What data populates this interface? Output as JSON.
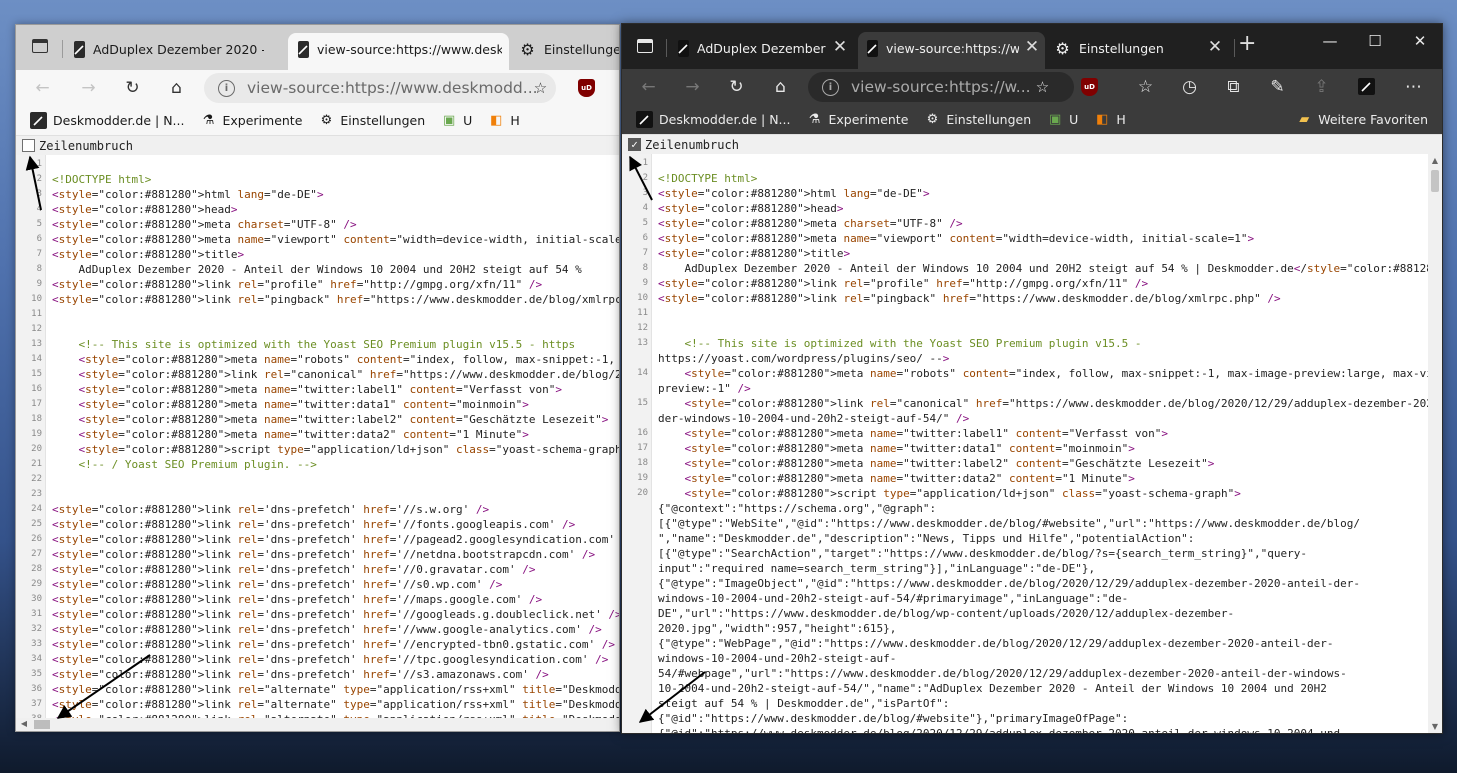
{
  "left_window": {
    "tabs": [
      {
        "label": "AdDuplex Dezember 2020 - A",
        "icon": "pen-icon"
      },
      {
        "label": "view-source:https://www.desk",
        "icon": "pen-icon"
      },
      {
        "label": "Einstellungen",
        "icon": "gear-icon"
      }
    ],
    "address": "view-source:https://www.deskmodd...",
    "favorites": [
      {
        "label": "Deskmodder.de | N...",
        "icon": "pen-icon"
      },
      {
        "label": "Experimente",
        "icon": "flask-icon"
      },
      {
        "label": "Einstellungen",
        "icon": "gear-icon"
      },
      {
        "label": "U",
        "icon": "extension-icon"
      },
      {
        "label": "H",
        "icon": "squares-icon"
      }
    ],
    "wrap_label": "Zeilenumbruch",
    "wrap_checked": false,
    "code_lines": [
      {
        "n": "1",
        "t": ""
      },
      {
        "n": "2",
        "t": "<!DOCTYPE html>"
      },
      {
        "n": "3",
        "t": "<html lang=\"de-DE\">"
      },
      {
        "n": "4",
        "t": "<head>"
      },
      {
        "n": "5",
        "t": "<meta charset=\"UTF-8\" />"
      },
      {
        "n": "6",
        "t": "<meta name=\"viewport\" content=\"width=device-width, initial-scale=1\">"
      },
      {
        "n": "7",
        "t": "<title>"
      },
      {
        "n": "8",
        "t": "    AdDuplex Dezember 2020 - Anteil der Windows 10 2004 und 20H2 steigt auf 54 %"
      },
      {
        "n": "9",
        "t": "<link rel=\"profile\" href=\"http://gmpg.org/xfn/11\" />"
      },
      {
        "n": "10",
        "t": "<link rel=\"pingback\" href=\"https://www.deskmodder.de/blog/xmlrpc.php\" />"
      },
      {
        "n": "11",
        "t": ""
      },
      {
        "n": "12",
        "t": ""
      },
      {
        "n": "13",
        "t": "    <!-- This site is optimized with the Yoast SEO Premium plugin v15.5 - https"
      },
      {
        "n": "14",
        "t": "    <meta name=\"robots\" content=\"index, follow, max-snippet:-1, max-image-previe"
      },
      {
        "n": "15",
        "t": "    <link rel=\"canonical\" href=\"https://www.deskmodder.de/blog/2020/12/29/addupl"
      },
      {
        "n": "16",
        "t": "    <meta name=\"twitter:label1\" content=\"Verfasst von\">"
      },
      {
        "n": "17",
        "t": "    <meta name=\"twitter:data1\" content=\"moinmoin\">"
      },
      {
        "n": "18",
        "t": "    <meta name=\"twitter:label2\" content=\"Geschätzte Lesezeit\">"
      },
      {
        "n": "19",
        "t": "    <meta name=\"twitter:data2\" content=\"1 Minute\">"
      },
      {
        "n": "20",
        "t": "    <script type=\"application/ld+json\" class=\"yoast-schema-graph\">{\"@context\":\"h"
      },
      {
        "n": "21",
        "t": "    <!-- / Yoast SEO Premium plugin. -->"
      },
      {
        "n": "22",
        "t": ""
      },
      {
        "n": "23",
        "t": ""
      },
      {
        "n": "24",
        "t": "<link rel='dns-prefetch' href='//s.w.org' />"
      },
      {
        "n": "25",
        "t": "<link rel='dns-prefetch' href='//fonts.googleapis.com' />"
      },
      {
        "n": "26",
        "t": "<link rel='dns-prefetch' href='//pagead2.googlesyndication.com' />"
      },
      {
        "n": "27",
        "t": "<link rel='dns-prefetch' href='//netdna.bootstrapcdn.com' />"
      },
      {
        "n": "28",
        "t": "<link rel='dns-prefetch' href='//0.gravatar.com' />"
      },
      {
        "n": "29",
        "t": "<link rel='dns-prefetch' href='//s0.wp.com' />"
      },
      {
        "n": "30",
        "t": "<link rel='dns-prefetch' href='//maps.google.com' />"
      },
      {
        "n": "31",
        "t": "<link rel='dns-prefetch' href='//googleads.g.doubleclick.net' />"
      },
      {
        "n": "32",
        "t": "<link rel='dns-prefetch' href='//www.google-analytics.com' />"
      },
      {
        "n": "33",
        "t": "<link rel='dns-prefetch' href='//encrypted-tbn0.gstatic.com' />"
      },
      {
        "n": "34",
        "t": "<link rel='dns-prefetch' href='//tpc.googlesyndication.com' />"
      },
      {
        "n": "35",
        "t": "<link rel='dns-prefetch' href='//s3.amazonaws.com' />"
      },
      {
        "n": "36",
        "t": "<link rel=\"alternate\" type=\"application/rss+xml\" title=\"Deskmodder.de &raquo; Fe"
      },
      {
        "n": "37",
        "t": "<link rel=\"alternate\" type=\"application/rss+xml\" title=\"Deskmodder.de &raquo; Ko"
      },
      {
        "n": "38",
        "t": "<link rel=\"alternate\" type=\"application/rss+xml\" title=\"Deskmodder.de &raquo; Ad"
      }
    ]
  },
  "right_window": {
    "tabs": [
      {
        "label": "AdDuplex Dezember 20",
        "icon": "pen-icon"
      },
      {
        "label": "view-source:https://ww",
        "icon": "pen-icon"
      },
      {
        "label": "Einstellungen",
        "icon": "gear-icon"
      }
    ],
    "address": "view-source:https://w...",
    "favorites": [
      {
        "label": "Deskmodder.de | N...",
        "icon": "pen-icon"
      },
      {
        "label": "Experimente",
        "icon": "flask-icon"
      },
      {
        "label": "Einstellungen",
        "icon": "gear-icon"
      },
      {
        "label": "U",
        "icon": "extension-icon"
      },
      {
        "label": "H",
        "icon": "squares-icon"
      }
    ],
    "other_favorites": "Weitere Favoriten",
    "wrap_label": "Zeilenumbruch",
    "wrap_checked": true,
    "code_lines": [
      {
        "n": "1",
        "t": ""
      },
      {
        "n": "2",
        "t": "<!DOCTYPE html>"
      },
      {
        "n": "3",
        "t": "<html lang=\"de-DE\">"
      },
      {
        "n": "4",
        "t": "<head>"
      },
      {
        "n": "5",
        "t": "<meta charset=\"UTF-8\" />"
      },
      {
        "n": "6",
        "t": "<meta name=\"viewport\" content=\"width=device-width, initial-scale=1\">"
      },
      {
        "n": "7",
        "t": "<title>"
      },
      {
        "n": "8",
        "t": "    AdDuplex Dezember 2020 - Anteil der Windows 10 2004 und 20H2 steigt auf 54 % | Deskmodder.de</title>"
      },
      {
        "n": "9",
        "t": "<link rel=\"profile\" href=\"http://gmpg.org/xfn/11\" />"
      },
      {
        "n": "10",
        "t": "<link rel=\"pingback\" href=\"https://www.deskmodder.de/blog/xmlrpc.php\" />"
      },
      {
        "n": "11",
        "t": ""
      },
      {
        "n": "12",
        "t": ""
      },
      {
        "n": "13",
        "t": "    <!-- This site is optimized with the Yoast SEO Premium plugin v15.5 -"
      },
      {
        "n": "",
        "t": "https://yoast.com/wordpress/plugins/seo/ -->"
      },
      {
        "n": "14",
        "t": "    <meta name=\"robots\" content=\"index, follow, max-snippet:-1, max-image-preview:large, max-video-"
      },
      {
        "n": "",
        "t": "preview:-1\" />"
      },
      {
        "n": "15",
        "t": "    <link rel=\"canonical\" href=\"https://www.deskmodder.de/blog/2020/12/29/adduplex-dezember-2020-anteil-"
      },
      {
        "n": "",
        "t": "der-windows-10-2004-und-20h2-steigt-auf-54/\" />"
      },
      {
        "n": "16",
        "t": "    <meta name=\"twitter:label1\" content=\"Verfasst von\">"
      },
      {
        "n": "17",
        "t": "    <meta name=\"twitter:data1\" content=\"moinmoin\">"
      },
      {
        "n": "18",
        "t": "    <meta name=\"twitter:label2\" content=\"Geschätzte Lesezeit\">"
      },
      {
        "n": "19",
        "t": "    <meta name=\"twitter:data2\" content=\"1 Minute\">"
      },
      {
        "n": "20",
        "t": "    <script type=\"application/ld+json\" class=\"yoast-schema-graph\">"
      },
      {
        "n": "",
        "t": "{\"@context\":\"https://schema.org\",\"@graph\":"
      },
      {
        "n": "",
        "t": "[{\"@type\":\"WebSite\",\"@id\":\"https://www.deskmodder.de/blog/#website\",\"url\":\"https://www.deskmodder.de/blog/"
      },
      {
        "n": "",
        "t": "\",\"name\":\"Deskmodder.de\",\"description\":\"News, Tipps und Hilfe\",\"potentialAction\":"
      },
      {
        "n": "",
        "t": "[{\"@type\":\"SearchAction\",\"target\":\"https://www.deskmodder.de/blog/?s={search_term_string}\",\"query-"
      },
      {
        "n": "",
        "t": "input\":\"required name=search_term_string\"}],\"inLanguage\":\"de-DE\"},"
      },
      {
        "n": "",
        "t": "{\"@type\":\"ImageObject\",\"@id\":\"https://www.deskmodder.de/blog/2020/12/29/adduplex-dezember-2020-anteil-der-"
      },
      {
        "n": "",
        "t": "windows-10-2004-und-20h2-steigt-auf-54/#primaryimage\",\"inLanguage\":\"de-"
      },
      {
        "n": "",
        "t": "DE\",\"url\":\"https://www.deskmodder.de/blog/wp-content/uploads/2020/12/adduplex-dezember-"
      },
      {
        "n": "",
        "t": "2020.jpg\",\"width\":957,\"height\":615},"
      },
      {
        "n": "",
        "t": "{\"@type\":\"WebPage\",\"@id\":\"https://www.deskmodder.de/blog/2020/12/29/adduplex-dezember-2020-anteil-der-"
      },
      {
        "n": "",
        "t": "windows-10-2004-und-20h2-steigt-auf-"
      },
      {
        "n": "",
        "t": "54/#webpage\",\"url\":\"https://www.deskmodder.de/blog/2020/12/29/adduplex-dezember-2020-anteil-der-windows-"
      },
      {
        "n": "",
        "t": "10-2004-und-20h2-steigt-auf-54/\",\"name\":\"AdDuplex Dezember 2020 - Anteil der Windows 10 2004 und 20H2"
      },
      {
        "n": "",
        "t": "steigt auf 54 % | Deskmodder.de\",\"isPartOf\":"
      },
      {
        "n": "",
        "t": "{\"@id\":\"https://www.deskmodder.de/blog/#website\"},\"primaryImageOfPage\":"
      },
      {
        "n": "",
        "t": "{\"@id\":\"https://www.deskmodder.de/blog/2020/12/29/adduplex-dezember-2020-anteil-der-windows-10-2004-und-"
      }
    ]
  }
}
